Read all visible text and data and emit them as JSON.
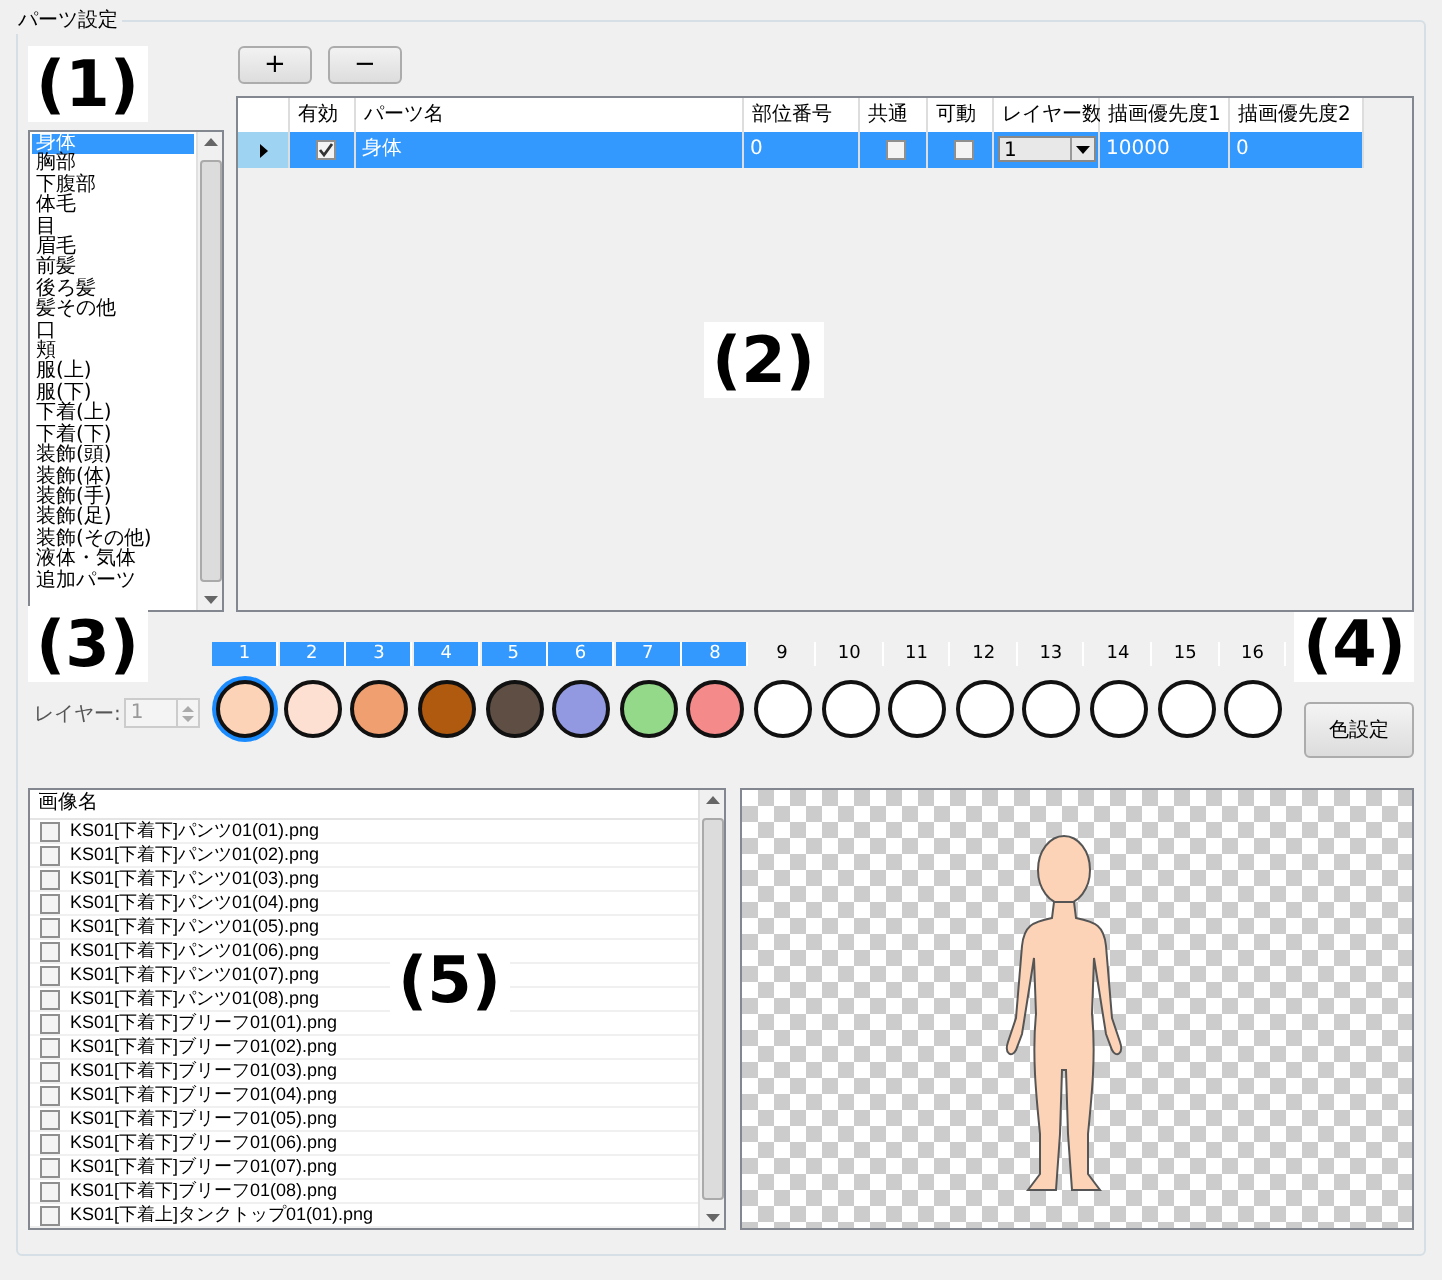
{
  "group": {
    "title": "パーツ設定"
  },
  "annotations": [
    "(1)",
    "(2)",
    "(3)",
    "(4)",
    "(5)"
  ],
  "parts_list": {
    "items": [
      {
        "label": "身体",
        "selected": true
      },
      {
        "label": "胸部",
        "selected": false
      },
      {
        "label": "下腹部",
        "selected": false
      },
      {
        "label": "体毛",
        "selected": false
      },
      {
        "label": "目",
        "selected": false
      },
      {
        "label": "眉毛",
        "selected": false
      },
      {
        "label": "前髪",
        "selected": false
      },
      {
        "label": "後ろ髪",
        "selected": false
      },
      {
        "label": "髪その他",
        "selected": false
      },
      {
        "label": "口",
        "selected": false
      },
      {
        "label": "頬",
        "selected": false
      },
      {
        "label": "服(上)",
        "selected": false
      },
      {
        "label": "服(下)",
        "selected": false
      },
      {
        "label": "下着(上)",
        "selected": false
      },
      {
        "label": "下着(下)",
        "selected": false
      },
      {
        "label": "装飾(頭)",
        "selected": false
      },
      {
        "label": "装飾(体)",
        "selected": false
      },
      {
        "label": "装飾(手)",
        "selected": false
      },
      {
        "label": "装飾(足)",
        "selected": false
      },
      {
        "label": "装飾(その他)",
        "selected": false
      },
      {
        "label": "液体・気体",
        "selected": false
      },
      {
        "label": "追加パーツ",
        "selected": false
      }
    ]
  },
  "toolbar": {
    "buttons": [
      "+",
      "−"
    ]
  },
  "grid": {
    "columns": [
      "有効",
      "パーツ名",
      "部位番号",
      "共通",
      "可動",
      "レイヤー数",
      "描画優先度1",
      "描画優先度2"
    ],
    "rows": [
      {
        "selected": true,
        "enabled": true,
        "name": "身体",
        "part_number": "0",
        "shared": false,
        "movable": false,
        "layer_count": "1",
        "priority_1": "10000",
        "priority_2": "0"
      }
    ]
  },
  "layers": {
    "label": "レイヤー:",
    "value": "1",
    "disabled": true,
    "swatches": [
      {
        "number": "1",
        "color": "#fcd3b6",
        "active": true,
        "selected": true
      },
      {
        "number": "2",
        "color": "#fde0d2",
        "active": true,
        "selected": false
      },
      {
        "number": "3",
        "color": "#f0a070",
        "active": true,
        "selected": false
      },
      {
        "number": "4",
        "color": "#b05a10",
        "active": true,
        "selected": false
      },
      {
        "number": "5",
        "color": "#5e4e44",
        "active": true,
        "selected": false
      },
      {
        "number": "6",
        "color": "#9299e0",
        "active": true,
        "selected": false
      },
      {
        "number": "7",
        "color": "#94d88a",
        "active": true,
        "selected": false
      },
      {
        "number": "8",
        "color": "#f58a8a",
        "active": true,
        "selected": false
      },
      {
        "number": "9",
        "color": "#ffffff",
        "active": false,
        "selected": false
      },
      {
        "number": "10",
        "color": "#ffffff",
        "active": false,
        "selected": false
      },
      {
        "number": "11",
        "color": "#ffffff",
        "active": false,
        "selected": false
      },
      {
        "number": "12",
        "color": "#ffffff",
        "active": false,
        "selected": false
      },
      {
        "number": "13",
        "color": "#ffffff",
        "active": false,
        "selected": false
      },
      {
        "number": "14",
        "color": "#ffffff",
        "active": false,
        "selected": false
      },
      {
        "number": "15",
        "color": "#ffffff",
        "active": false,
        "selected": false
      },
      {
        "number": "16",
        "color": "#ffffff",
        "active": false,
        "selected": false
      }
    ]
  },
  "color_button": "色設定",
  "images": {
    "header": "画像名",
    "items": [
      {
        "name": "KS01[下着下]パンツ01(01).png",
        "checked": false
      },
      {
        "name": "KS01[下着下]パンツ01(02).png",
        "checked": false
      },
      {
        "name": "KS01[下着下]パンツ01(03).png",
        "checked": false
      },
      {
        "name": "KS01[下着下]パンツ01(04).png",
        "checked": false
      },
      {
        "name": "KS01[下着下]パンツ01(05).png",
        "checked": false
      },
      {
        "name": "KS01[下着下]パンツ01(06).png",
        "checked": false
      },
      {
        "name": "KS01[下着下]パンツ01(07).png",
        "checked": false
      },
      {
        "name": "KS01[下着下]パンツ01(08).png",
        "checked": false
      },
      {
        "name": "KS01[下着下]ブリーフ01(01).png",
        "checked": false
      },
      {
        "name": "KS01[下着下]ブリーフ01(02).png",
        "checked": false
      },
      {
        "name": "KS01[下着下]ブリーフ01(03).png",
        "checked": false
      },
      {
        "name": "KS01[下着下]ブリーフ01(04).png",
        "checked": false
      },
      {
        "name": "KS01[下着下]ブリーフ01(05).png",
        "checked": false
      },
      {
        "name": "KS01[下着下]ブリーフ01(06).png",
        "checked": false
      },
      {
        "name": "KS01[下着下]ブリーフ01(07).png",
        "checked": false
      },
      {
        "name": "KS01[下着下]ブリーフ01(08).png",
        "checked": false
      },
      {
        "name": "KS01[下着上]タンクトップ01(01).png",
        "checked": false
      }
    ]
  }
}
